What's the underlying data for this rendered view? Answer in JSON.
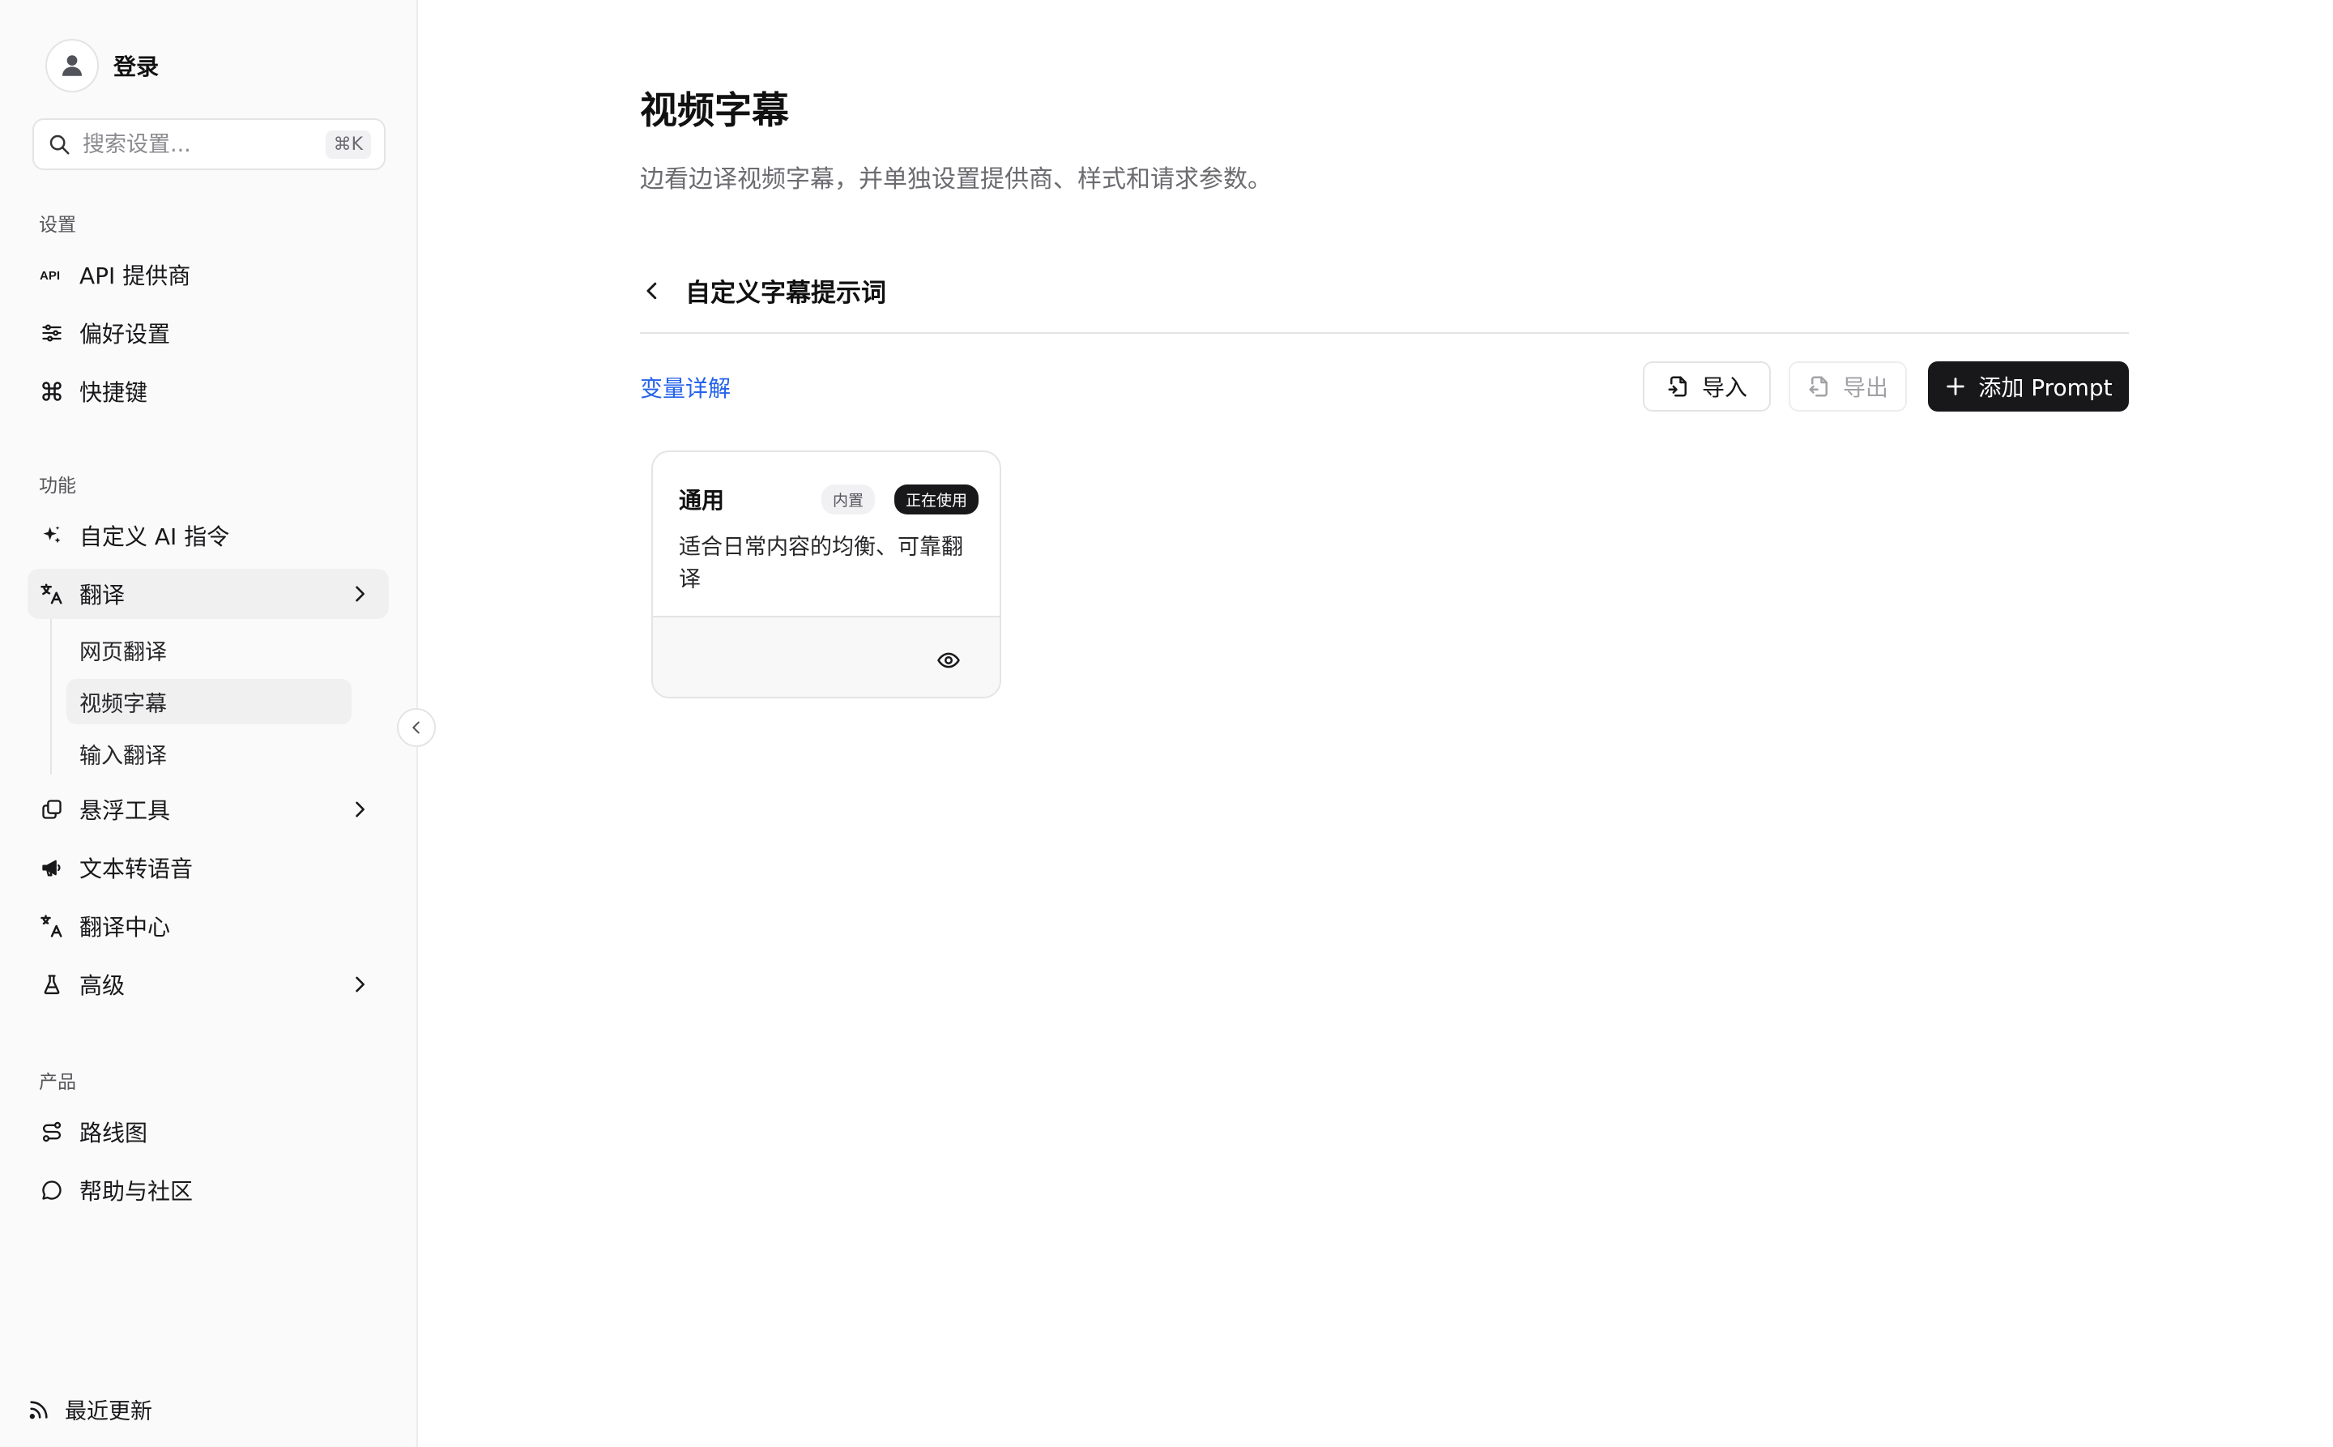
{
  "sidebar": {
    "user_label": "登录",
    "search_placeholder": "搜索设置...",
    "search_shortcut": "⌘K",
    "sections": [
      {
        "title": "设置",
        "items": [
          {
            "label": "API 提供商",
            "icon": "api-icon"
          },
          {
            "label": "偏好设置",
            "icon": "sliders-icon"
          },
          {
            "label": "快捷键",
            "icon": "command-icon"
          }
        ]
      },
      {
        "title": "功能",
        "items": [
          {
            "label": "自定义 AI 指令",
            "icon": "sparkles-icon"
          },
          {
            "label": "翻译",
            "icon": "translate-icon",
            "expanded": true,
            "subitems": [
              {
                "label": "网页翻译"
              },
              {
                "label": "视频字幕",
                "active": true
              },
              {
                "label": "输入翻译"
              }
            ]
          },
          {
            "label": "悬浮工具",
            "icon": "layers-icon"
          },
          {
            "label": "文本转语音",
            "icon": "megaphone-icon"
          },
          {
            "label": "翻译中心",
            "icon": "language-icon"
          },
          {
            "label": "高级",
            "icon": "flask-icon"
          }
        ]
      },
      {
        "title": "产品",
        "items": [
          {
            "label": "路线图",
            "icon": "route-icon"
          },
          {
            "label": "帮助与社区",
            "icon": "chat-bubble-icon"
          }
        ]
      }
    ],
    "footer_label": "最近更新"
  },
  "main": {
    "title": "视频字幕",
    "description": "边看边译视频字幕，并单独设置提供商、样式和请求参数。",
    "section_title": "自定义字幕提示词",
    "variables_link": "变量详解",
    "buttons": {
      "import": "导入",
      "export": "导出",
      "add": "添加 Prompt"
    },
    "cards": [
      {
        "name": "通用",
        "builtin_badge": "内置",
        "active_badge": "正在使用",
        "description": "适合日常内容的均衡、可靠翻译"
      }
    ]
  },
  "colors": {
    "accent": "#18181b",
    "link": "#2563eb",
    "sidebar_bg": "#fafafa"
  }
}
